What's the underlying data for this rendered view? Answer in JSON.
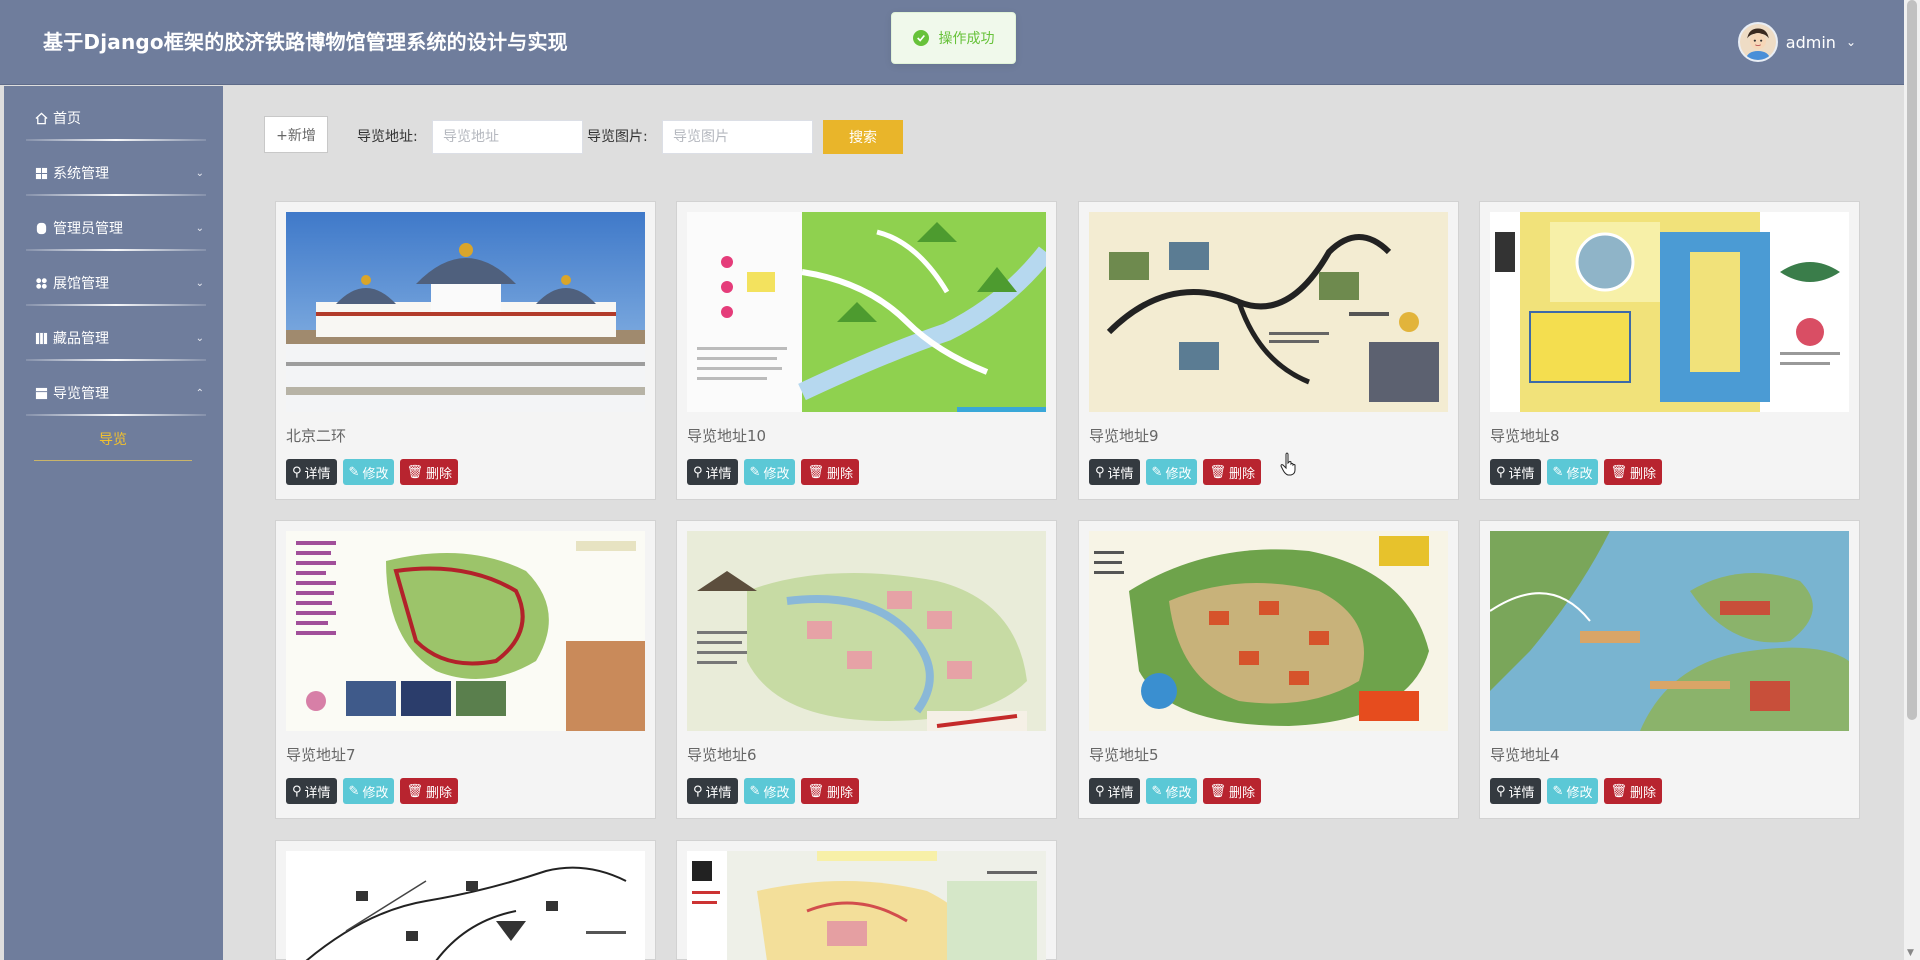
{
  "header": {
    "title": "基于Django框架的胶济铁路博物馆管理系统的设计与实现",
    "user": "admin"
  },
  "toast": {
    "message": "操作成功",
    "color": "#67c23a"
  },
  "sidebar": {
    "items": [
      {
        "label": "首页",
        "icon": "home-icon"
      },
      {
        "label": "系统管理",
        "icon": "grid-icon"
      },
      {
        "label": "管理员管理",
        "icon": "user-icon"
      },
      {
        "label": "展馆管理",
        "icon": "apps-icon"
      },
      {
        "label": "藏品管理",
        "icon": "grid-icon"
      },
      {
        "label": "导览管理",
        "icon": "grid-icon"
      }
    ],
    "active_sub": "导览"
  },
  "toolbar": {
    "add_label": "+新增",
    "address_label": "导览地址:",
    "address_placeholder": "导览地址",
    "image_label": "导览图片:",
    "image_placeholder": "导览图片",
    "search_label": "搜索",
    "search_color": "#e9b52a"
  },
  "actions": {
    "detail": "详情",
    "edit": "修改",
    "delete": "删除"
  },
  "cards": [
    {
      "title": "北京二环",
      "image": "palace-photo"
    },
    {
      "title": "导览地址10",
      "image": "green-map"
    },
    {
      "title": "导览地址9",
      "image": "tour-map"
    },
    {
      "title": "导览地址8",
      "image": "park-map"
    },
    {
      "title": "导览地址7",
      "image": "garden-map"
    },
    {
      "title": "导览地址6",
      "image": "resort-map"
    },
    {
      "title": "导览地址5",
      "image": "theme-park-map"
    },
    {
      "title": "导览地址4",
      "image": "lake-map"
    },
    {
      "title": "",
      "image": "line-map"
    },
    {
      "title": "",
      "image": "campus-map"
    }
  ]
}
